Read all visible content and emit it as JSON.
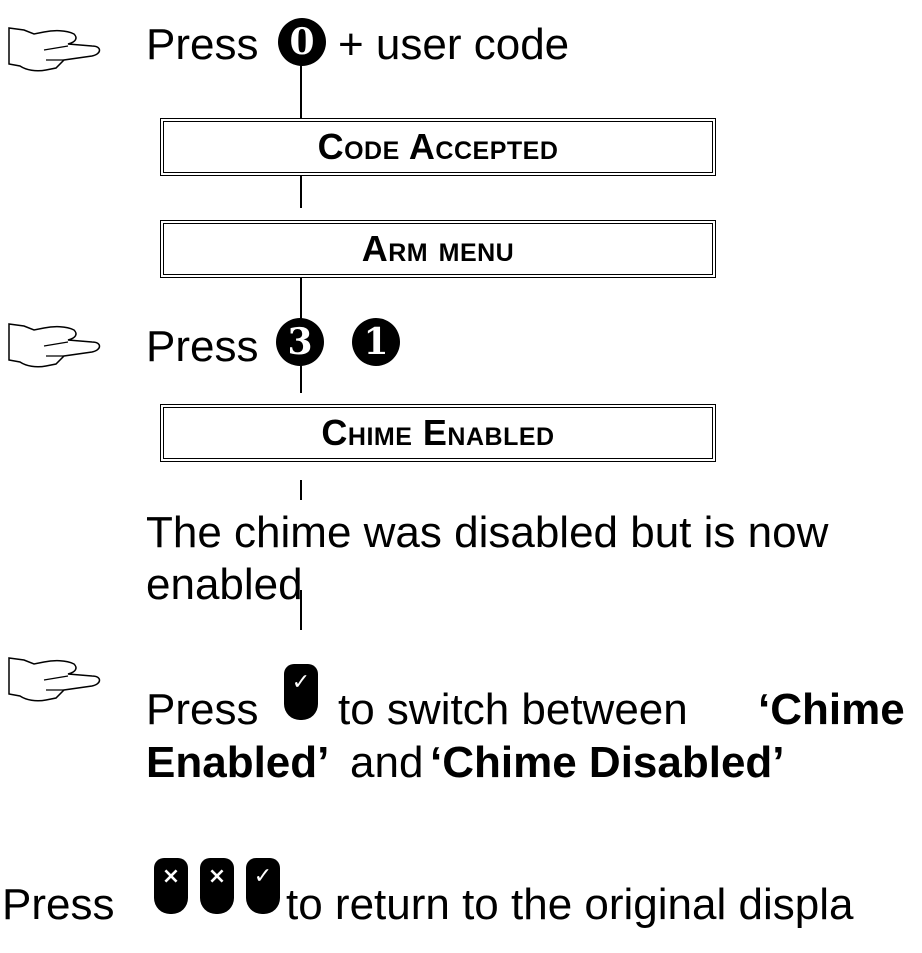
{
  "step1": {
    "press": "Press",
    "key": "0",
    "suffix": "+ user code"
  },
  "display1": "Code Accepted",
  "display2": "Arm menu",
  "step2": {
    "press": "Press",
    "key_a": "3",
    "key_b": "1"
  },
  "display3": "Chime Enabled",
  "note": {
    "line1": "The chime was disabled but is now",
    "line2": "enabled"
  },
  "step3": {
    "press": "Press",
    "key": "✓",
    "text1": "to switch between",
    "bold1": "‘Chime",
    "bold2": "Enabled’",
    "text2": "and",
    "bold3": "‘Chime Disabled’"
  },
  "step4": {
    "press": "Press",
    "keys": [
      "×",
      "×",
      "✓"
    ],
    "text": "to return to the original displa"
  }
}
